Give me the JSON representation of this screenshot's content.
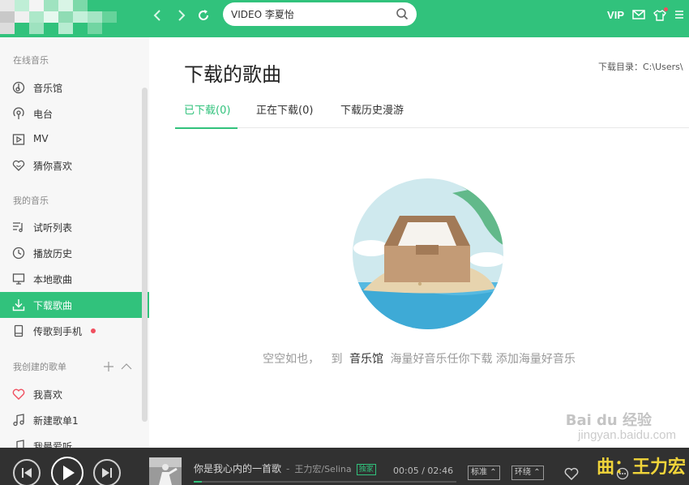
{
  "top": {
    "search_value": "VIDEO 李夏怡",
    "vip_label": "VIP"
  },
  "sidebar": {
    "sections": [
      "在线音乐",
      "我的音乐",
      "我创建的歌单"
    ],
    "online": [
      "音乐馆",
      "电台",
      "MV",
      "猜你喜欢"
    ],
    "mine": [
      "试听列表",
      "播放历史",
      "本地歌曲",
      "下载歌曲",
      "传歌到手机"
    ],
    "created": [
      "我喜欢",
      "新建歌单1",
      "我最爱听"
    ],
    "active_item": "下载歌曲"
  },
  "main": {
    "title": "下载的歌曲",
    "download_dir": "下载目录：C:\\Users\\",
    "tabs": [
      "已下载(0)",
      "正在下载(0)",
      "下载历史漫游"
    ],
    "empty_prefix": "空空如也，",
    "empty_to": "到",
    "empty_link": "音乐馆",
    "empty_suffix": "海量好音乐任你下载 添加海量好音乐"
  },
  "player": {
    "song_title": "你是我心内的一首歌",
    "artist": "王力宏/Selina",
    "tag": "独家",
    "time": "00:05 / 02:46",
    "quality": "标准",
    "mode": "环绕",
    "progress": 0.03
  },
  "watermark": {
    "text": "曲：王力宏",
    "site": "Bai du 经验",
    "site_url": "jingyan.baidu.com"
  },
  "colors": {
    "brand": "#31c27c",
    "player_bg": "#313131",
    "sidebar_bg": "#f7f7f7"
  }
}
